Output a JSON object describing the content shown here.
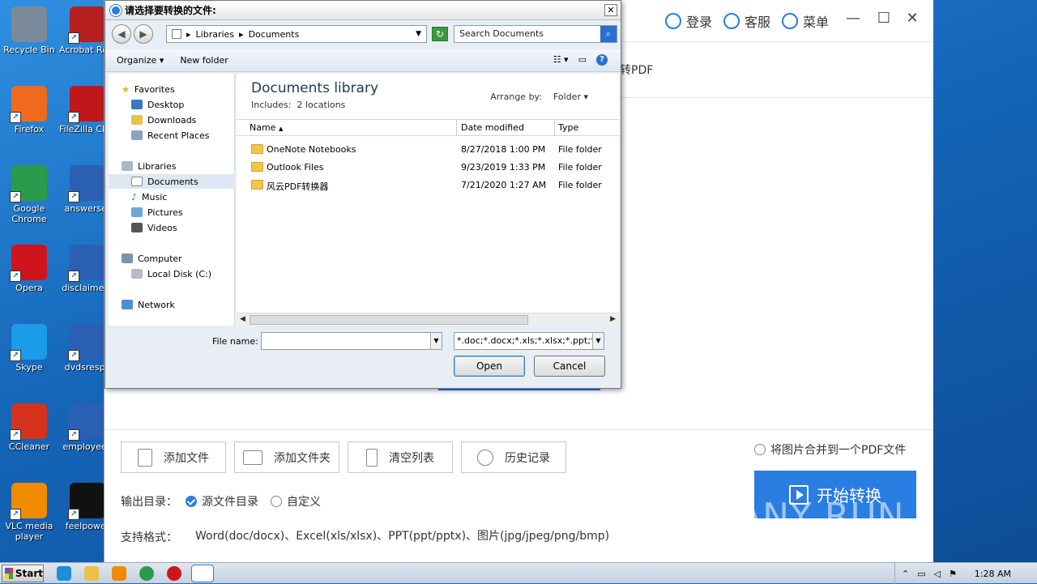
{
  "desktop": {
    "icons": [
      {
        "label": "Recycle Bin",
        "color": "#7a8a99"
      },
      {
        "label": "Acrobat Reader DC",
        "color": "#b51f1f"
      },
      {
        "label": "Firefox",
        "color": "#f06a1d"
      },
      {
        "label": "FileZilla Client",
        "color": "#c0171c"
      },
      {
        "label": "Google Chrome",
        "color": "#2a9b4a"
      },
      {
        "label": "answerser",
        "color": "#2b5fb4"
      },
      {
        "label": "Opera",
        "color": "#d0141c"
      },
      {
        "label": "disclaimern",
        "color": "#2b5fb4"
      },
      {
        "label": "Skype",
        "color": "#1c9be8"
      },
      {
        "label": "dvdsrespe",
        "color": "#2b5fb4"
      },
      {
        "label": "CCleaner",
        "color": "#d5331d"
      },
      {
        "label": "employeep",
        "color": "#2b5fb4"
      },
      {
        "label": "VLC media player",
        "color": "#f08a00"
      },
      {
        "label": "feelpower",
        "color": "#111111"
      }
    ]
  },
  "app": {
    "login": "登录",
    "service": "客服",
    "menu": "菜单",
    "hint": "转PDF",
    "add_file": "添加文件",
    "add_folder": "添加文件夹",
    "clear_list": "清空列表",
    "history": "历史记录",
    "merge_images": "将图片合并到一个PDF文件",
    "output_dir_label": "输出目录：",
    "source_dir": "源文件目录",
    "custom": "自定义",
    "support_label": "支持格式：",
    "support_formats": "Word(doc/docx)、Excel(xls/xlsx)、PPT(ppt/pptx)、图片(jpg/jpeg/png/bmp)",
    "start_convert": "开始转换",
    "accent": "#2a7de1"
  },
  "watermark": "ANY RUN",
  "dialog": {
    "title": "请选择要转换的文件:",
    "breadcrumb": [
      "Libraries",
      "Documents"
    ],
    "search_placeholder": "Search Documents",
    "organize": "Organize",
    "new_folder": "New folder",
    "nav": {
      "favorites": "Favorites",
      "desktop": "Desktop",
      "downloads": "Downloads",
      "recent": "Recent Places",
      "libraries": "Libraries",
      "documents": "Documents",
      "music": "Music",
      "pictures": "Pictures",
      "videos": "Videos",
      "computer": "Computer",
      "local_disk": "Local Disk (C:)",
      "network": "Network"
    },
    "library_title": "Documents library",
    "includes": "Includes:",
    "locations": "2 locations",
    "arrange_by": "Arrange by:",
    "arrange_value": "Folder",
    "columns": {
      "name": "Name",
      "date": "Date modified",
      "type": "Type"
    },
    "rows": [
      {
        "name": "OneNote Notebooks",
        "date": "8/27/2018 1:00 PM",
        "type": "File folder"
      },
      {
        "name": "Outlook Files",
        "date": "9/23/2019 1:33 PM",
        "type": "File folder"
      },
      {
        "name": "风云PDF转换器",
        "date": "7/21/2020 1:27 AM",
        "type": "File folder"
      }
    ],
    "file_name_label": "File name:",
    "file_name_value": "",
    "file_type": "*.doc;*.docx;*.xls;*.xlsx;*.ppt;*.p",
    "open": "Open",
    "cancel": "Cancel"
  },
  "taskbar": {
    "start": "Start",
    "clock": "1:28 AM"
  }
}
